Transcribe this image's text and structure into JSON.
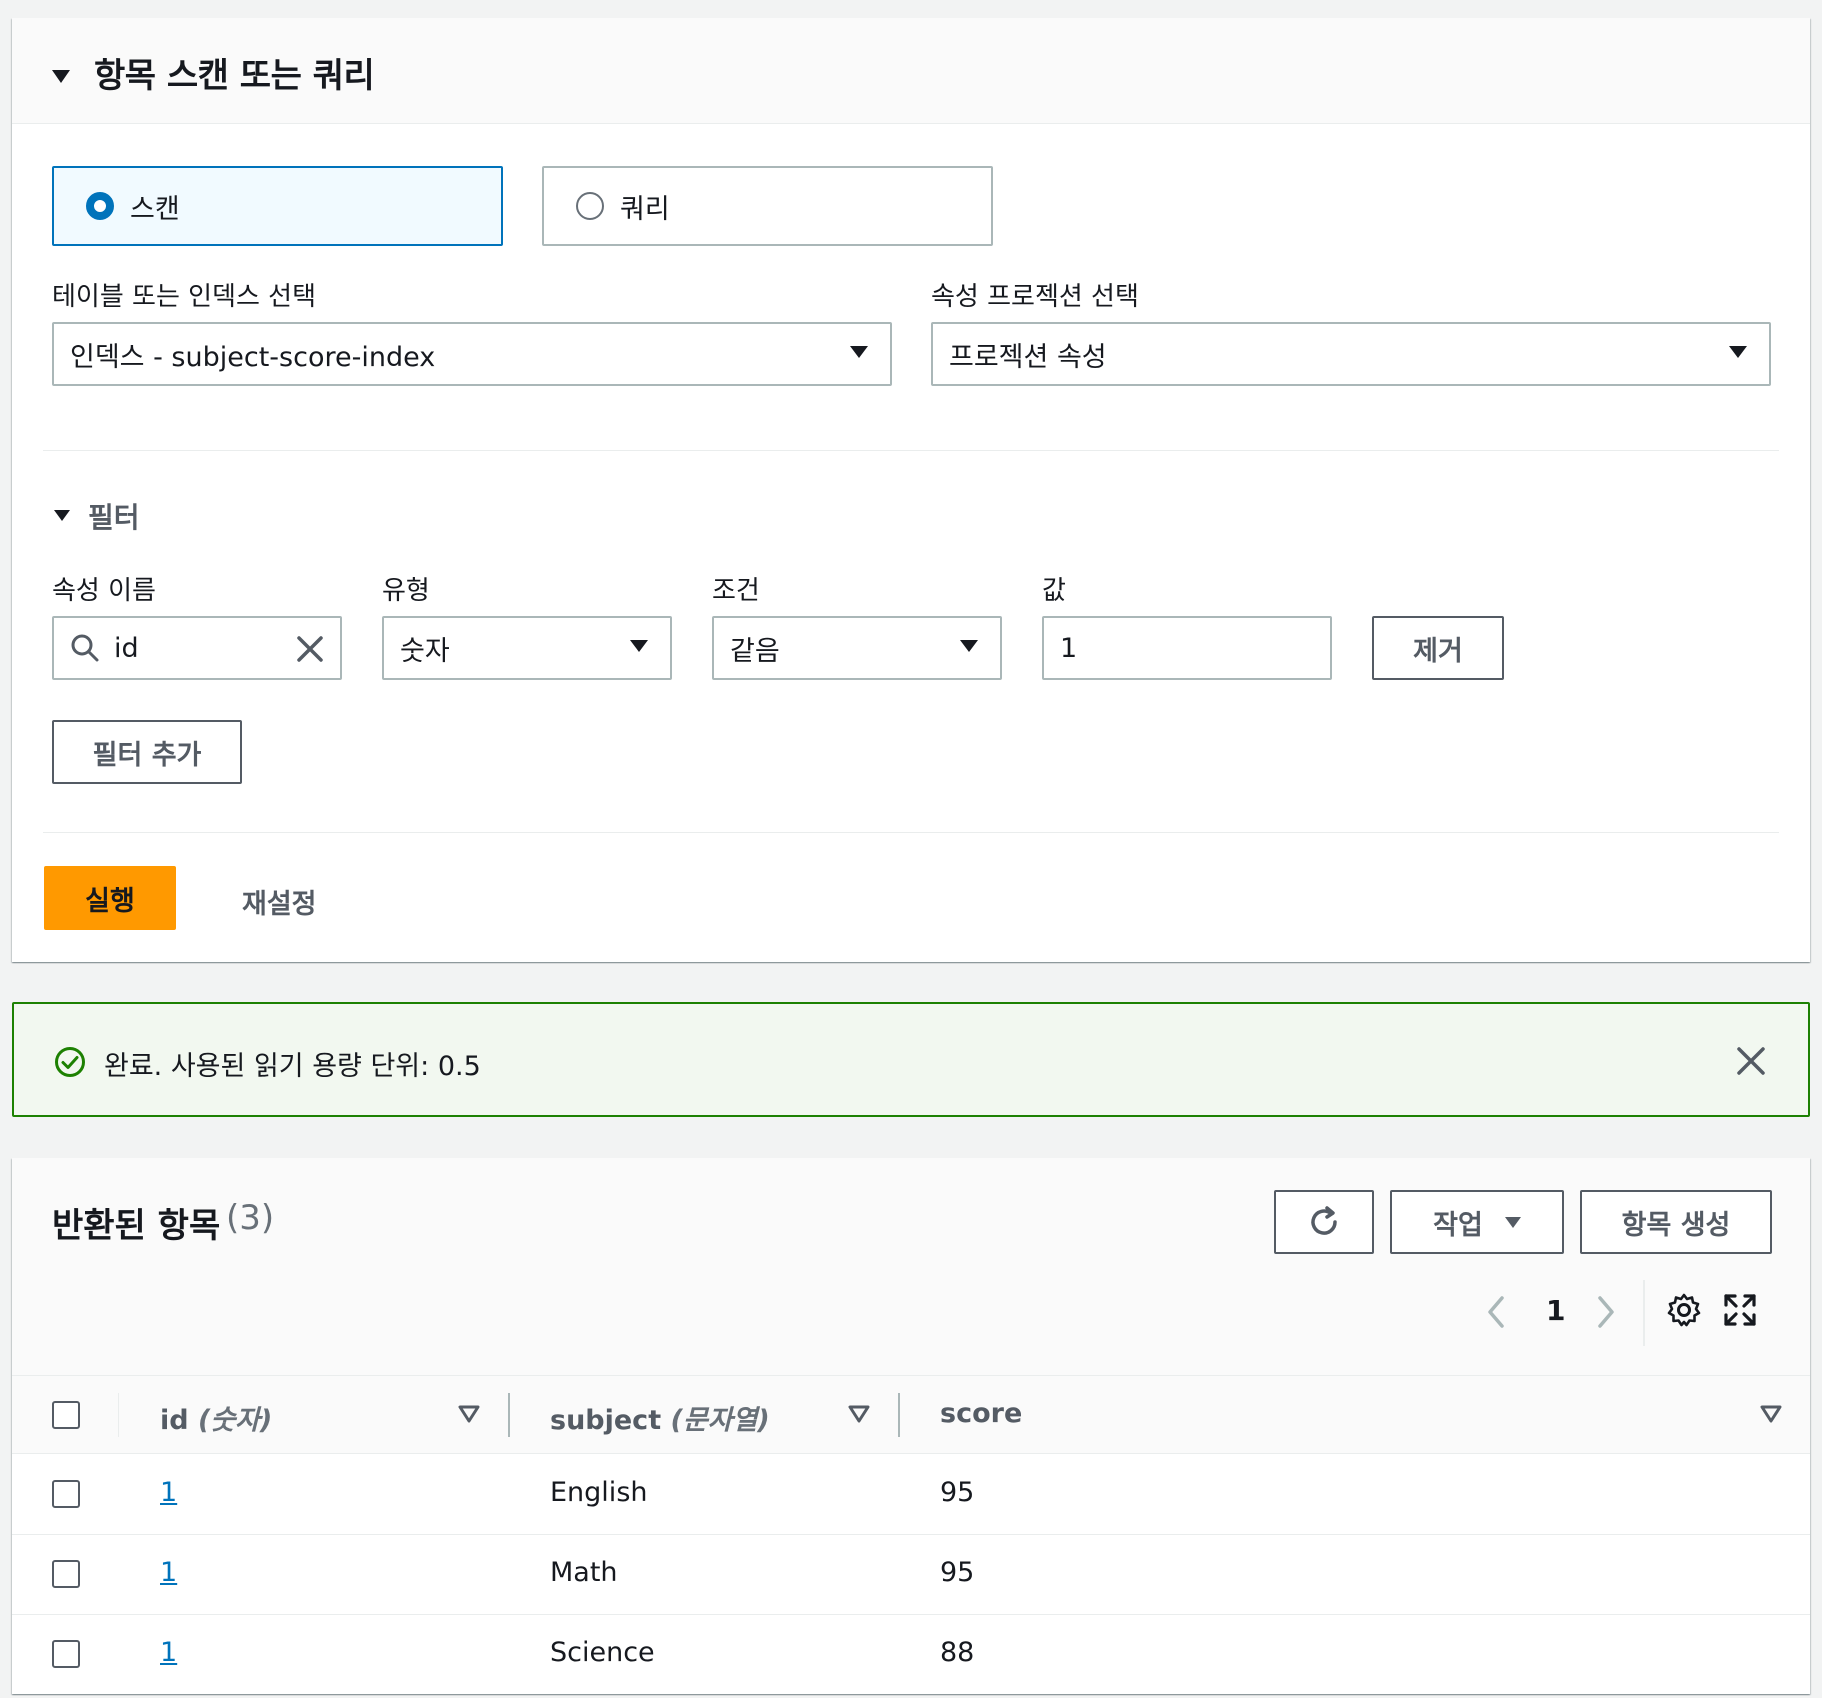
{
  "scan_query": {
    "title": "항목 스캔 또는 쿼리",
    "mode_options": [
      {
        "label": "스캔",
        "selected": true
      },
      {
        "label": "쿼리",
        "selected": false
      }
    ],
    "table_select": {
      "label": "테이블 또는 인덱스 선택",
      "value": "인덱스 - subject-score-index"
    },
    "projection_select": {
      "label": "속성 프로젝션 선택",
      "value": "프로젝션 속성"
    },
    "filter": {
      "title": "필터",
      "attribute_label": "속성 이름",
      "attribute_value": "id",
      "type_label": "유형",
      "type_value": "숫자",
      "condition_label": "조건",
      "condition_value": "같음",
      "value_label": "값",
      "value_value": "1",
      "remove_label": "제거",
      "add_filter_label": "필터 추가"
    },
    "run_label": "실행",
    "reset_label": "재설정"
  },
  "flash": {
    "message": "완료. 사용된 읽기 용량 단위: 0.5",
    "status": "success"
  },
  "results": {
    "title": "반환된 항목",
    "count": "(3)",
    "actions_label": "작업",
    "create_item_label": "항목 생성",
    "page": "1",
    "columns": [
      {
        "name": "id",
        "type": "(숫자)"
      },
      {
        "name": "subject",
        "type": "(문자열)"
      },
      {
        "name": "score",
        "type": ""
      }
    ],
    "rows": [
      {
        "id": "1",
        "subject": "English",
        "score": "95"
      },
      {
        "id": "1",
        "subject": "Math",
        "score": "95"
      },
      {
        "id": "1",
        "subject": "Science",
        "score": "88"
      }
    ]
  },
  "colors": {
    "primary_button": "#ff9900",
    "link": "#0073bb",
    "success": "#1d8102",
    "selected_radio": "#0073bb"
  }
}
